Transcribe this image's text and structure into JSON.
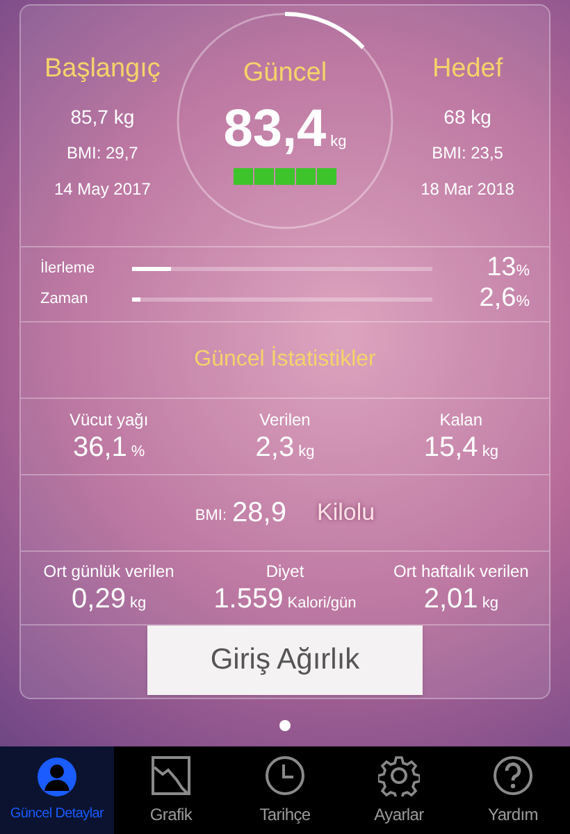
{
  "summary": {
    "start": {
      "title": "Başlangıç",
      "weight": "85,7 kg",
      "bmi": "BMI: 29,7",
      "date": "14 May 2017"
    },
    "current": {
      "title": "Güncel",
      "weight": "83,4",
      "unit": "kg",
      "level": 0.13,
      "segments": [
        {
          "on": true
        },
        {
          "on": true
        },
        {
          "on": true
        },
        {
          "on": true
        },
        {
          "on": true
        }
      ]
    },
    "goal": {
      "title": "Hedef",
      "weight": "68 kg",
      "bmi": "BMI: 23,5",
      "date": "18 Mar 2018"
    }
  },
  "progress": [
    {
      "label": "İlerleme",
      "level": 0.13,
      "value": "13",
      "unit": "%"
    },
    {
      "label": "Zaman",
      "level": 0.026,
      "value": "2,6",
      "unit": "%"
    }
  ],
  "stats_title": "Güncel İstatistikler",
  "stats": [
    {
      "label": "Vücut yağı",
      "value": "36,1",
      "unit": "%"
    },
    {
      "label": "Verilen",
      "value": "2,3",
      "unit": "kg"
    },
    {
      "label": "Kalan",
      "value": "15,4",
      "unit": "kg"
    }
  ],
  "bmi": {
    "label": "BMI:",
    "value": "28,9",
    "category": "Kilolu"
  },
  "averages": [
    {
      "label": "Ort günlük verilen",
      "value": "0,29",
      "unit": "kg"
    },
    {
      "label": "Diyet",
      "value": "1.559",
      "unit": "Kalori/gün"
    },
    {
      "label": "Ort haftalık verilen",
      "value": "2,01",
      "unit": "kg"
    }
  ],
  "enter_button": "Giriş Ağırlık",
  "page_dots": [
    {
      "selected": true
    }
  ],
  "tabs": [
    {
      "label": "Güncel Detaylar",
      "kind": "person",
      "selected": true
    },
    {
      "label": "Grafik",
      "kind": "chart",
      "selected": false
    },
    {
      "label": "Tarihçe",
      "kind": "clock",
      "selected": false
    },
    {
      "label": "Ayarlar",
      "kind": "gear",
      "selected": false
    },
    {
      "label": "Yardım",
      "kind": "help",
      "selected": false
    }
  ]
}
